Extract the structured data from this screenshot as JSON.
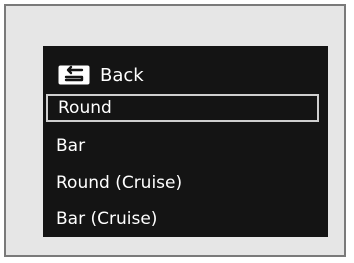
{
  "menu": {
    "back_label": "Back",
    "back_icon": "back-arrow-icon",
    "items": [
      {
        "label": "Round",
        "selected": true
      },
      {
        "label": "Bar",
        "selected": false
      },
      {
        "label": "Round (Cruise)",
        "selected": false
      },
      {
        "label": "Bar (Cruise)",
        "selected": false
      }
    ]
  },
  "colors": {
    "screen_bg": "#141414",
    "frame_bg": "#e6e6e6",
    "text": "#ffffff",
    "selection_border": "#cfcfcf"
  }
}
